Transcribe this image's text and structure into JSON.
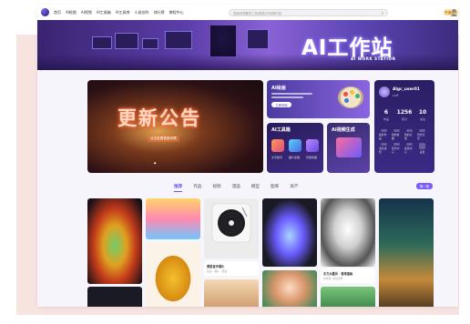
{
  "nav": {
    "items": [
      "首页",
      "AI绘图",
      "AI视频",
      "AI工具箱",
      "AI工具库",
      "小说创作",
      "排行榜",
      "教程中心"
    ],
    "search_placeholder": "搜索你想要的工具/模型/作品等内容",
    "vip_label": "开通会员"
  },
  "banner": {
    "title": "AI工作站",
    "subtitle": "AI WORK STATION"
  },
  "notice": {
    "title": "更新公告",
    "subtitle": "点击查看更新详情"
  },
  "panels": {
    "draw_title": "AI绘画",
    "draw_button": "立即体验",
    "tools_title": "AI工具箱",
    "tool_labels": [
      "文字助手",
      "图片处理",
      "智能修图"
    ],
    "video_title": "AI视频生成"
  },
  "user": {
    "name": "Algc_user01",
    "level": "Lv.6",
    "stats": [
      {
        "value": "6",
        "label": "作品"
      },
      {
        "value": "1256",
        "label": "积分"
      },
      {
        "value": "10",
        "label": "关注"
      }
    ],
    "grid": [
      "我的作品",
      "我的收藏",
      "我的点赞",
      "历史记录",
      "消息通知",
      "任务中心",
      "会员中心",
      "设置"
    ]
  },
  "tabs": [
    "推荐",
    "作品",
    "视频",
    "漫画",
    "模型",
    "图库",
    "资产"
  ],
  "refresh_label": "换一换",
  "cards": {
    "vinyl_title": "黑胶音乐唱片",
    "vinyl_sub": "复古 · 唱片 · 质感",
    "art_title": "东方水墨风 · 意境插画",
    "art_sub": "创作者: 墨染流年"
  },
  "colors": {
    "accent": "#7055e6",
    "banner": "#5b3da8",
    "vip": "#ffdf9a"
  }
}
